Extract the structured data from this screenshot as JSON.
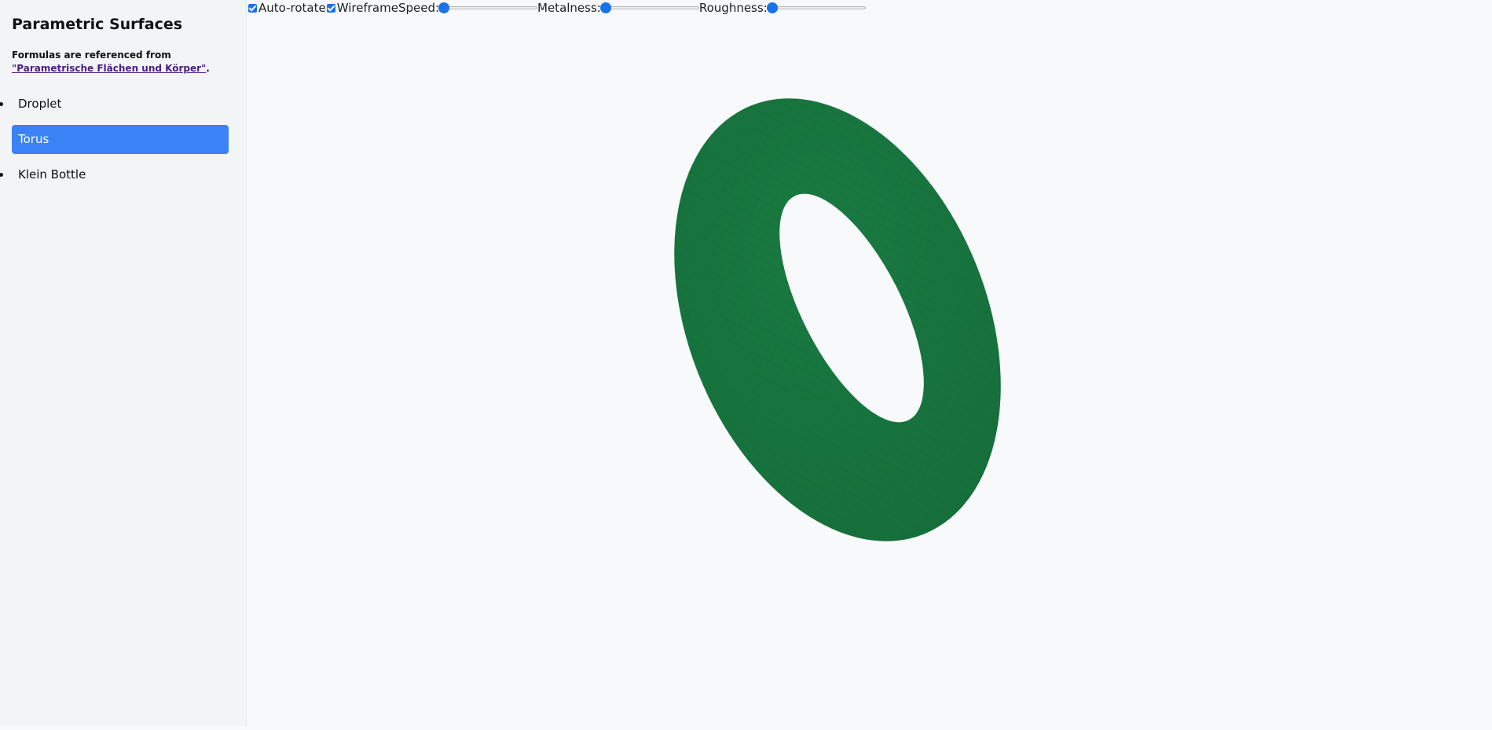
{
  "sidebar": {
    "title": "Parametric Surfaces",
    "reference_prefix": "Formulas are referenced from ",
    "reference_link": "\"Parametrische Flächen und Körper\"",
    "reference_suffix": ".",
    "items": [
      {
        "label": "Droplet",
        "active": false
      },
      {
        "label": "Torus",
        "active": true
      },
      {
        "label": "Klein Bottle",
        "active": false
      }
    ]
  },
  "controls": {
    "auto_rotate": {
      "label": "Auto-rotate",
      "checked": true
    },
    "wireframe": {
      "label": "Wireframe",
      "checked": true
    },
    "speed": {
      "label": "Speed:",
      "value": 0
    },
    "metalness": {
      "label": "Metalness:",
      "value": 0
    },
    "roughness": {
      "label": "Roughness:",
      "value": 0
    }
  },
  "scene": {
    "surface": "Torus",
    "surface_color": "#1a7a42",
    "wire_color": "#0f5a2c",
    "background_color": "#f8f9fb"
  },
  "colors": {
    "accent": "#3b82f6",
    "control_accent": "#1a73e8",
    "link": "#4b1d86"
  }
}
